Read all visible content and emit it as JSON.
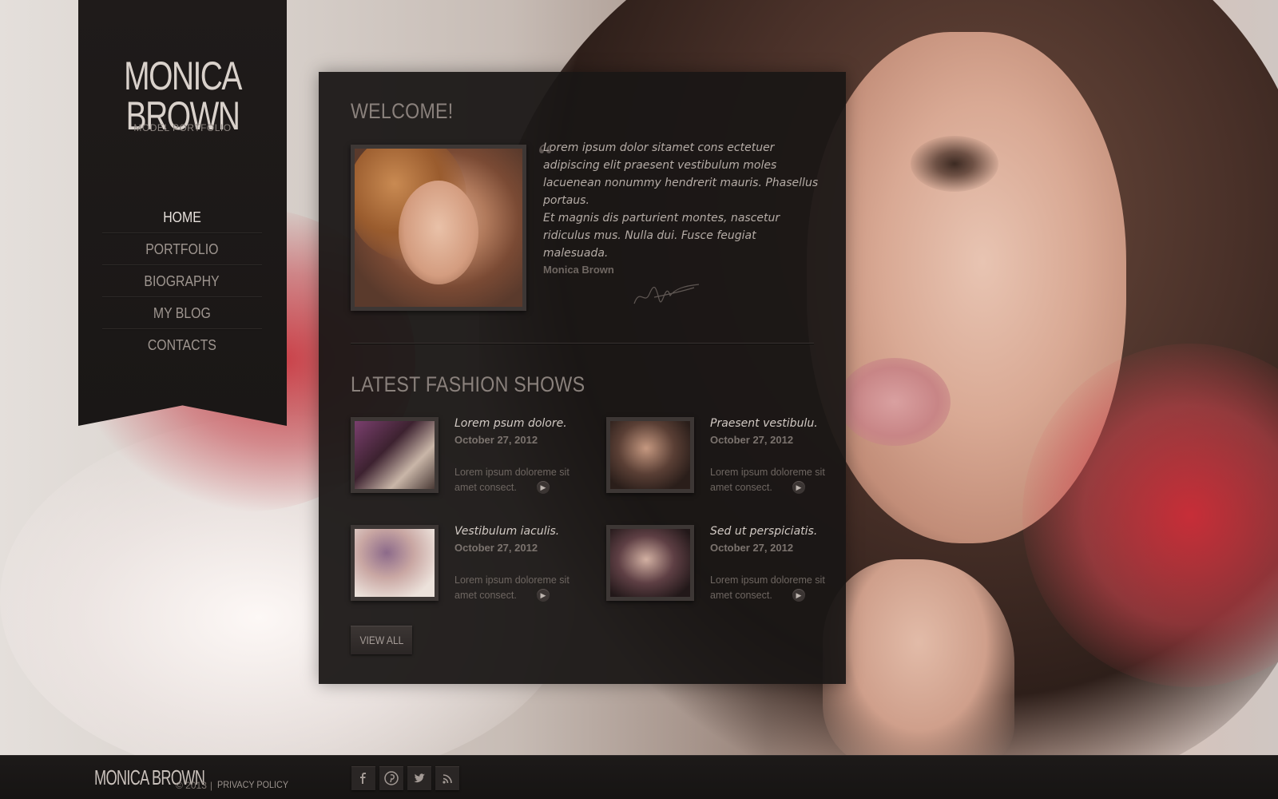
{
  "sidebar": {
    "logo_title": "MONICA BROWN",
    "logo_subtitle": "MODEL PORTFOLIO",
    "nav": [
      {
        "label": "HOME",
        "active": true
      },
      {
        "label": "PORTFOLIO",
        "active": false
      },
      {
        "label": "BIOGRAPHY",
        "active": false
      },
      {
        "label": "MY BLOG",
        "active": false
      },
      {
        "label": "CONTACTS",
        "active": false
      }
    ]
  },
  "welcome": {
    "heading": "WELCOME!",
    "quote_mark": "“",
    "paragraph_1": "Lorem ipsum dolor sitamet cons ectetuer adipiscing elit praesent vestibulum moles lacuenean nonummy hendrerit mauris. Phasellus portaus.",
    "paragraph_2": "Et magnis dis parturient montes, nascetur ridiculus mus. Nulla dui. Fusce feugiat malesuada.",
    "author": "Monica Brown"
  },
  "shows": {
    "heading": "LATEST FASHION SHOWS",
    "items": [
      {
        "title": "Lorem psum dolore.",
        "date": "October 27, 2012",
        "excerpt": "Lorem ipsum doloreme sit amet consect."
      },
      {
        "title": "Praesent vestibulu.",
        "date": "October 27, 2012",
        "excerpt": "Lorem ipsum doloreme sit amet consect."
      },
      {
        "title": "Vestibulum iaculis.",
        "date": "October 27, 2012",
        "excerpt": "Lorem ipsum doloreme sit amet consect."
      },
      {
        "title": "Sed ut perspiciatis.",
        "date": "October 27, 2012",
        "excerpt": "Lorem ipsum doloreme sit amet consect."
      }
    ],
    "view_all_label": "VIEW ALL"
  },
  "footer": {
    "logo": "MONICA BROWN",
    "copyright": "© 2013",
    "separator": "|",
    "privacy_label": "PRIVACY POLICY",
    "social_icons": [
      "facebook-icon",
      "pinterest-icon",
      "twitter-icon",
      "rss-icon"
    ]
  },
  "colors": {
    "panel_bg": "#1a1615",
    "sidebar_bg": "#1f1b1a",
    "text_light": "#e8e2dd",
    "text_muted": "#8a817c"
  }
}
